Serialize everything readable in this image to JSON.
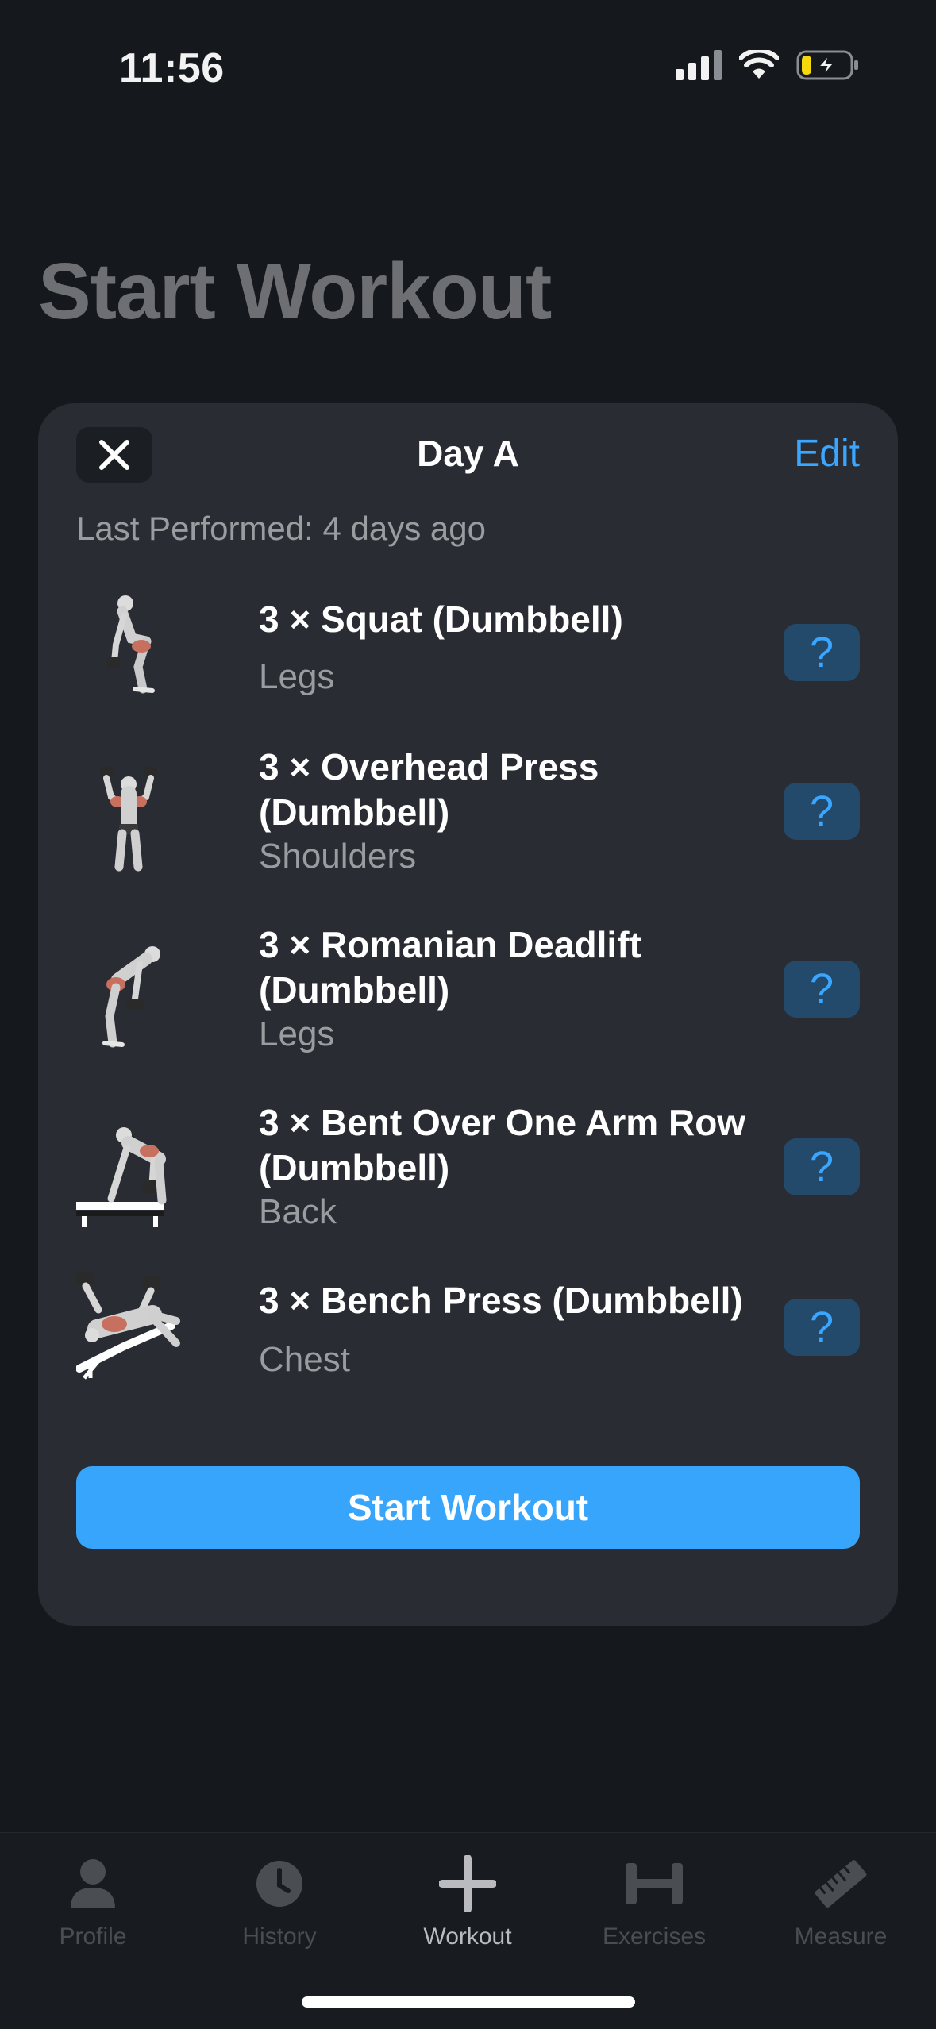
{
  "status_bar": {
    "time": "11:56"
  },
  "page": {
    "title": "Start Workout"
  },
  "card": {
    "title": "Day A",
    "edit_label": "Edit",
    "last_performed": "Last Performed: 4 days ago",
    "exercises": [
      {
        "name": "3 × Squat (Dumbbell)",
        "muscle": "Legs"
      },
      {
        "name": "3 × Overhead Press (Dumbbell)",
        "muscle": "Shoulders"
      },
      {
        "name": "3 × Romanian Deadlift (Dumbbell)",
        "muscle": "Legs"
      },
      {
        "name": "3 × Bent Over One Arm Row (Dumbbell)",
        "muscle": "Back"
      },
      {
        "name": "3 × Bench Press (Dumbbell)",
        "muscle": "Chest"
      }
    ],
    "help_label": "?",
    "start_label": "Start Workout"
  },
  "tabbar": {
    "tabs": [
      {
        "label": "Profile",
        "icon": "person-icon"
      },
      {
        "label": "History",
        "icon": "clock-icon"
      },
      {
        "label": "Workout",
        "icon": "plus-icon",
        "active": true
      },
      {
        "label": "Exercises",
        "icon": "dumbbell-icon"
      },
      {
        "label": "Measure",
        "icon": "ruler-icon"
      }
    ]
  },
  "colors": {
    "accent": "#36a5fb",
    "background": "#15181c",
    "card": "#292d33"
  }
}
